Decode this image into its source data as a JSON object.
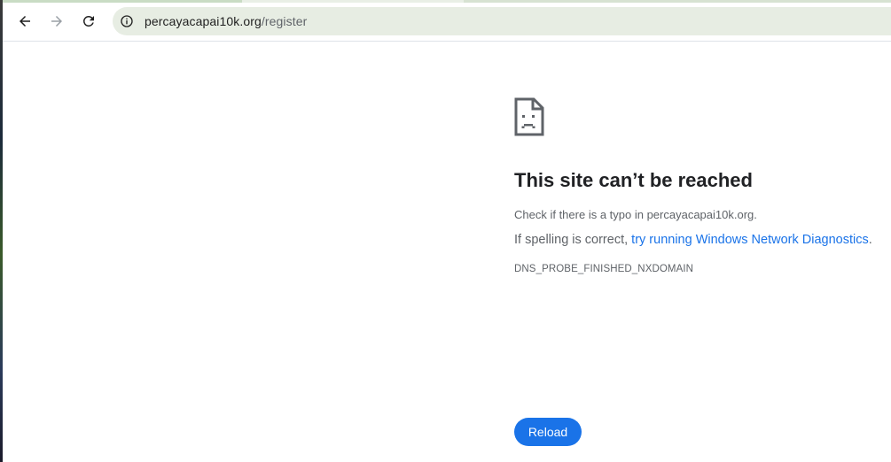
{
  "browser": {
    "url_domain": "percayacapai10k.org",
    "url_path": "/register",
    "icons": {
      "back": "arrow-left-icon",
      "forward": "arrow-right-icon",
      "reload": "reload-icon",
      "site_info": "info-icon"
    }
  },
  "error_page": {
    "icon": "sad-document-icon",
    "title": "This site can’t be reached",
    "typo_check": "Check if there is a typo in percayacapai10k.org.",
    "spelling_prefix": "If spelling is correct, ",
    "diagnostics_link": "try running Windows Network Diagnostics",
    "spelling_suffix": ".",
    "error_code": "DNS_PROBE_FINISHED_NXDOMAIN",
    "reload_button": "Reload"
  },
  "colors": {
    "accent": "#1a73e8",
    "omnibox_bg": "#e7ede3",
    "text_primary": "#202124",
    "text_secondary": "#5f6368"
  }
}
